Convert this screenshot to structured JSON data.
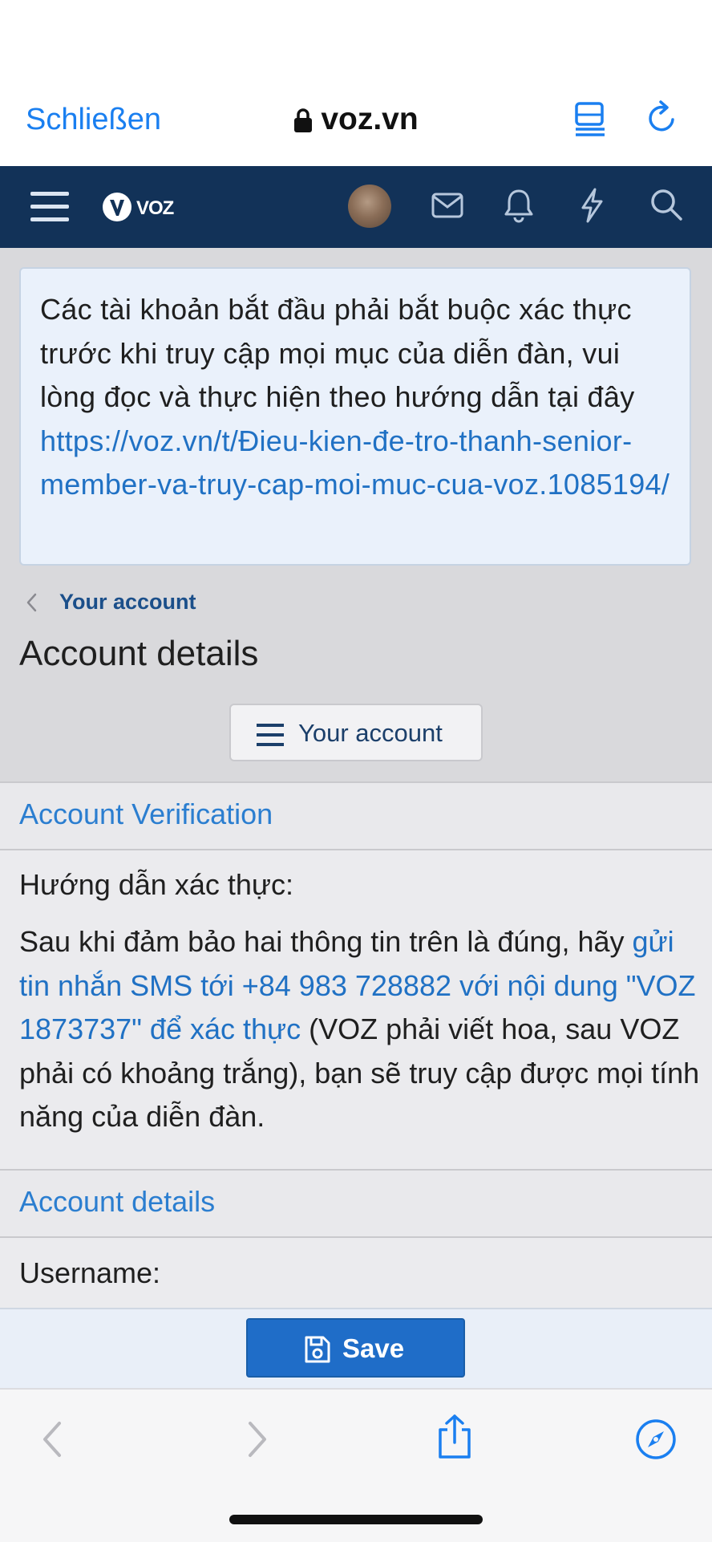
{
  "browser": {
    "close_label": "Schließen",
    "url": "voz.vn",
    "accent_color": "#1a7ff0"
  },
  "site_header": {
    "logo_text": "VOZ",
    "bg_color": "#123258",
    "icons": [
      "menu-icon",
      "avatar",
      "mail-icon",
      "bell-icon",
      "bolt-icon",
      "search-icon"
    ]
  },
  "notice": {
    "text": "Các tài khoản bắt đầu phải bắt buộc xác thực trước khi truy cập mọi mục của diễn đàn, vui lòng đọc và thực hiện theo hướng dẫn tại đây ",
    "link": "https://voz.vn/t/Đieu-kien-đe-tro-thanh-senior-member-va-truy-cap-moi-muc-cua-voz.1085194/"
  },
  "breadcrumb": {
    "label": "Your account"
  },
  "page_title": "Account details",
  "account_menu_button": "Your account",
  "verification": {
    "heading": "Account Verification",
    "label": "Hướng dẫn xác thực:",
    "text_before": "Sau khi đảm bảo hai thông tin trên là đúng, hãy ",
    "link_text": "gửi tin nhắn SMS tới +84 983 728882 với nội dung \"VOZ 1873737\" để xác thực",
    "text_after": " (VOZ phải viết hoa, sau VOZ phải có khoảng trắng), bạn sẽ truy cập được mọi tính năng của diễn đàn."
  },
  "account_details": {
    "heading": "Account details",
    "username_label": "Username:"
  },
  "save_button": "Save"
}
